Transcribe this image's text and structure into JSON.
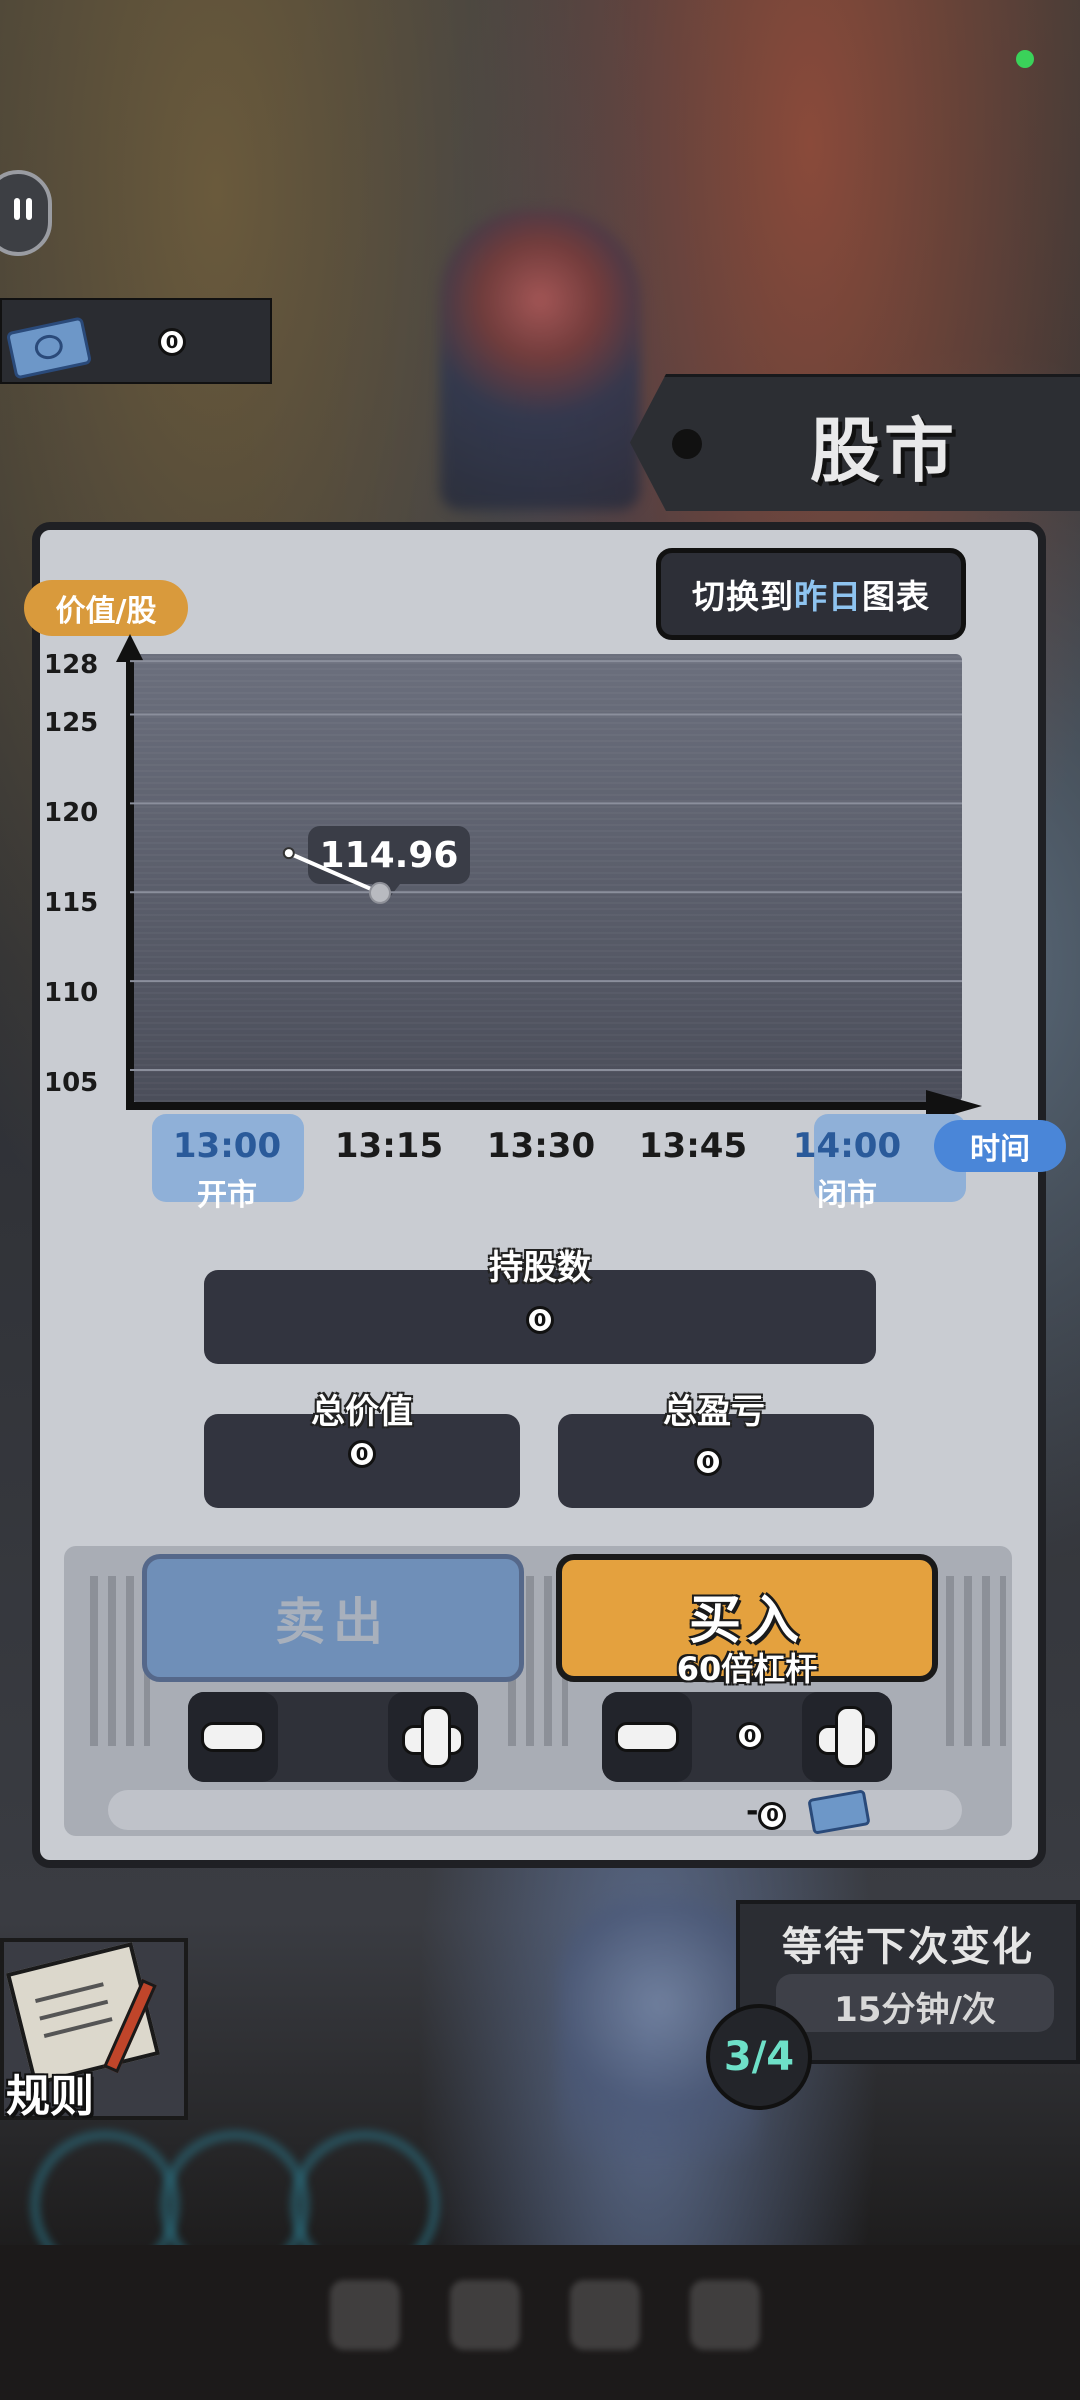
{
  "header": {
    "title": "股市",
    "money_value": "0",
    "chat_icon": "chat-bubble-icon",
    "currency_icon": "ticket-icon"
  },
  "chart": {
    "switch_button": {
      "prefix": "切换到",
      "highlight": "昨日",
      "suffix": "图表"
    },
    "y_label": "价值/股",
    "x_label": "时间",
    "tooltip": "114.96",
    "open_label": "开市",
    "close_label": "闭市"
  },
  "chart_data": {
    "type": "line",
    "title": "",
    "xlabel": "时间",
    "ylabel": "价值/股",
    "x": [
      "13:00",
      "13:15",
      "13:30",
      "13:45",
      "14:00"
    ],
    "ylim": [
      105,
      128
    ],
    "y_ticks": [
      "128",
      "125",
      "120",
      "115",
      "110",
      "105"
    ],
    "series": [
      {
        "points": [
          {
            "x": "13:06",
            "y": 117.2
          },
          {
            "x": "13:15",
            "y": 114.96
          }
        ]
      }
    ],
    "highlighted_value": 114.96,
    "grid": true
  },
  "stats": {
    "holdings_label": "持股数",
    "holdings_value": "0",
    "total_value_label": "总价值",
    "total_value": "0",
    "total_pnl_label": "总盈亏",
    "total_pnl": "0"
  },
  "actions": {
    "sell_label": "卖出",
    "buy_label": "买入",
    "buy_sub": "60倍杠杆",
    "sell_quantity": "",
    "buy_quantity": "0",
    "cost_prefix": "-",
    "cost_value": "0"
  },
  "rules": {
    "label": "规则"
  },
  "wait": {
    "title": "等待下次变化",
    "rate": "15分钟/次",
    "round": "3/4"
  },
  "colors": {
    "accent_orange": "#e4a13e",
    "accent_blue": "#4a86d8",
    "panel_bg": "#c9ccd2",
    "dark": "#2d2f37",
    "badge_teal": "#6ee0c8"
  }
}
